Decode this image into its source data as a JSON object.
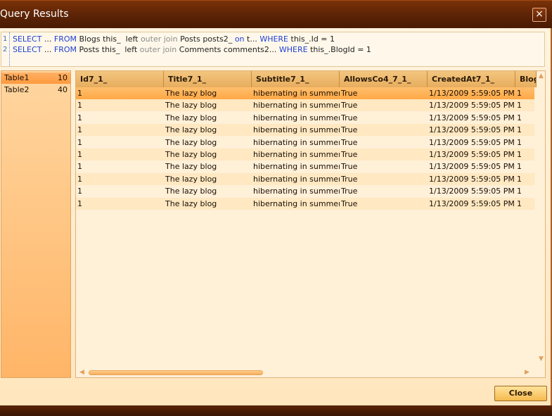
{
  "window": {
    "title": "Query Results"
  },
  "sql": {
    "lines": [
      {
        "num": "1",
        "tokens": [
          {
            "t": "SELECT",
            "c": "kw"
          },
          {
            "t": " ... ",
            "c": ""
          },
          {
            "t": "FROM",
            "c": "kw"
          },
          {
            "t": " Blogs this_  left ",
            "c": ""
          },
          {
            "t": "outer join",
            "c": "kw2"
          },
          {
            "t": " Posts posts2_ ",
            "c": ""
          },
          {
            "t": "on",
            "c": "kw"
          },
          {
            "t": " t... ",
            "c": ""
          },
          {
            "t": "WHERE",
            "c": "kw"
          },
          {
            "t": " this_.Id = 1",
            "c": ""
          }
        ]
      },
      {
        "num": "2",
        "tokens": [
          {
            "t": "SELECT",
            "c": "kw"
          },
          {
            "t": " ... ",
            "c": ""
          },
          {
            "t": "FROM",
            "c": "kw"
          },
          {
            "t": " Posts this_  left ",
            "c": ""
          },
          {
            "t": "outer join",
            "c": "kw2"
          },
          {
            "t": " Comments comments2... ",
            "c": ""
          },
          {
            "t": "WHERE",
            "c": "kw"
          },
          {
            "t": " this_.BlogId = 1",
            "c": ""
          }
        ]
      }
    ]
  },
  "tables": [
    {
      "name": "Table1",
      "count": "10",
      "selected": true
    },
    {
      "name": "Table2",
      "count": "40",
      "selected": false
    }
  ],
  "grid": {
    "columns": [
      "Id7_1_",
      "Title7_1_",
      "Subtitle7_1_",
      "AllowsCo4_7_1_",
      "CreatedAt7_1_",
      "Blog"
    ],
    "rows": [
      [
        "1",
        "The lazy blog",
        "hibernating in summer",
        "True",
        "1/13/2009 5:59:05 PM",
        "1"
      ],
      [
        "1",
        "The lazy blog",
        "hibernating in summer",
        "True",
        "1/13/2009 5:59:05 PM",
        "1"
      ],
      [
        "1",
        "The lazy blog",
        "hibernating in summer",
        "True",
        "1/13/2009 5:59:05 PM",
        "1"
      ],
      [
        "1",
        "The lazy blog",
        "hibernating in summer",
        "True",
        "1/13/2009 5:59:05 PM",
        "1"
      ],
      [
        "1",
        "The lazy blog",
        "hibernating in summer",
        "True",
        "1/13/2009 5:59:05 PM",
        "1"
      ],
      [
        "1",
        "The lazy blog",
        "hibernating in summer",
        "True",
        "1/13/2009 5:59:05 PM",
        "1"
      ],
      [
        "1",
        "The lazy blog",
        "hibernating in summer",
        "True",
        "1/13/2009 5:59:05 PM",
        "1"
      ],
      [
        "1",
        "The lazy blog",
        "hibernating in summer",
        "True",
        "1/13/2009 5:59:05 PM",
        "1"
      ],
      [
        "1",
        "The lazy blog",
        "hibernating in summer",
        "True",
        "1/13/2009 5:59:05 PM",
        "1"
      ],
      [
        "1",
        "The lazy blog",
        "hibernating in summer",
        "True",
        "1/13/2009 5:59:05 PM",
        "1"
      ]
    ],
    "selected_row": 0
  },
  "buttons": {
    "close": "Close",
    "close_x": "×"
  },
  "icons": {
    "scroll_up": "▲",
    "scroll_down": "▼",
    "scroll_left": "◀",
    "scroll_right": "▶"
  },
  "colors": {
    "titlebar": "#5b2306",
    "accent": "#ff9a3d",
    "keyword": "#1f3fd6"
  }
}
